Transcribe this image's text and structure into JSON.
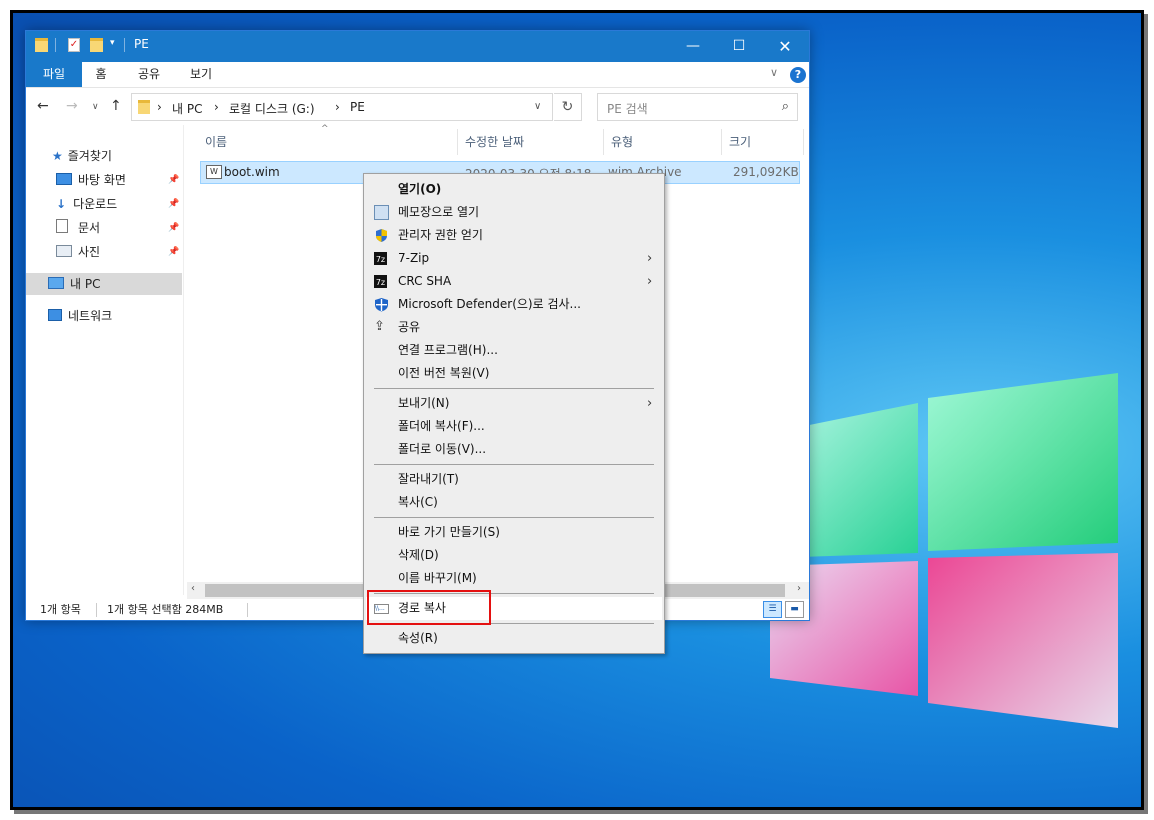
{
  "window": {
    "title": "PE",
    "ribbon_tabs": [
      "파일",
      "홈",
      "공유",
      "보기"
    ]
  },
  "address": {
    "crumbs": [
      "내 PC",
      "로컬 디스크 (G:)",
      "PE"
    ],
    "search_placeholder": "PE 검색"
  },
  "sidebar": {
    "items": [
      {
        "label": "즐겨찾기",
        "icon": "star-icon"
      },
      {
        "label": "바탕 화면",
        "icon": "desktop-icon",
        "pinned": true
      },
      {
        "label": "다운로드",
        "icon": "download-icon",
        "pinned": true
      },
      {
        "label": "문서",
        "icon": "document-icon",
        "pinned": true
      },
      {
        "label": "사진",
        "icon": "picture-icon",
        "pinned": true
      },
      {
        "label": "내 PC",
        "icon": "computer-icon",
        "selected": true
      },
      {
        "label": "네트워크",
        "icon": "network-icon"
      }
    ]
  },
  "columns": [
    "이름",
    "수정한 날짜",
    "유형",
    "크기"
  ],
  "files": [
    {
      "name": "boot.wim",
      "date": "2020-03-30 오전 8:18",
      "type": "wim Archive",
      "size": "291,092KB"
    }
  ],
  "status": {
    "count": "1개 항목",
    "selection": "1개 항목 선택함 284MB"
  },
  "context_menu": {
    "items": [
      {
        "label": "열기(O)",
        "bold": true
      },
      {
        "label": "메모장으로 열기",
        "icon": "notepad-icon"
      },
      {
        "label": "관리자 권한 얻기",
        "icon": "uac-shield-icon"
      },
      {
        "label": "7-Zip",
        "icon": "7zip-icon",
        "submenu": true
      },
      {
        "label": "CRC SHA",
        "icon": "7zip-icon",
        "submenu": true
      },
      {
        "label": "Microsoft Defender(으)로 검사...",
        "icon": "defender-icon"
      },
      {
        "label": "공유",
        "icon": "share-icon"
      },
      {
        "label": "연결 프로그램(H)..."
      },
      {
        "label": "이전 버전 복원(V)"
      },
      {
        "separator": true
      },
      {
        "label": "보내기(N)",
        "submenu": true
      },
      {
        "label": "폴더에 복사(F)..."
      },
      {
        "label": "폴더로 이동(V)..."
      },
      {
        "separator": true
      },
      {
        "label": "잘라내기(T)"
      },
      {
        "label": "복사(C)"
      },
      {
        "separator": true
      },
      {
        "label": "바로 가기 만들기(S)"
      },
      {
        "label": "삭제(D)"
      },
      {
        "label": "이름 바꾸기(M)"
      },
      {
        "separator": true
      },
      {
        "label": "경로 복사",
        "icon": "path-copy-icon",
        "highlighted": true
      },
      {
        "separator": true
      },
      {
        "label": "속성(R)"
      }
    ]
  },
  "colors": {
    "title_bar": "#1979ca",
    "selection": "#cce8ff",
    "highlight_box": "#e41010"
  }
}
